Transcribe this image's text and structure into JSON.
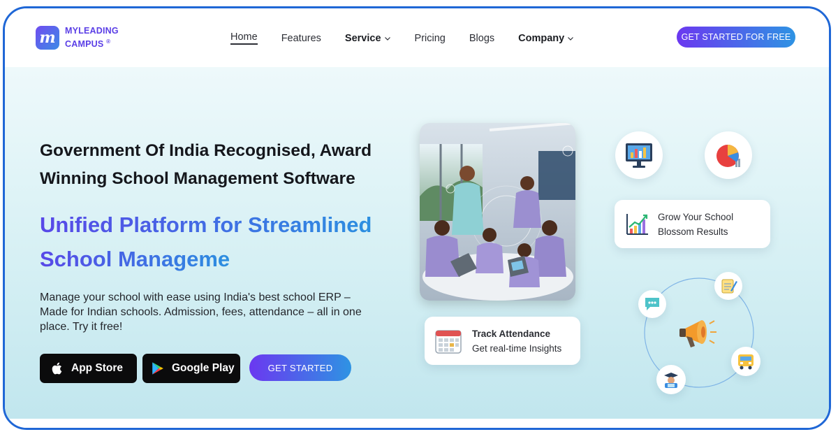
{
  "brand": {
    "logo_letter": "m",
    "line1": "MYLEADING",
    "line2": "CAMPUS",
    "registered": "®",
    "color": "#5a3ee6"
  },
  "nav": {
    "items": [
      {
        "label": "Home",
        "active": true
      },
      {
        "label": "Features"
      },
      {
        "label": "Service",
        "dropdown": true
      },
      {
        "label": "Pricing"
      },
      {
        "label": "Blogs"
      },
      {
        "label": "Company",
        "dropdown": true
      }
    ],
    "cta": "GET STARTED FOR FREE"
  },
  "hero": {
    "title_line1": "Government Of India Recognised, Award",
    "title_line2": "Winning School Management Software",
    "subtitle_line1": "Unified Platform for Streamlined",
    "subtitle_line2": "School Manageme",
    "description_line1": "Manage your school with ease using India's best school ERP –",
    "description_line2": "Made for Indian schools. Admission, fees, attendance – all in one",
    "description_line3": "place. Try it free!",
    "app_store": "App Store",
    "google_play": "Google Play",
    "cta": "GET STARTED"
  },
  "cards": {
    "attendance_title": "Track Attendance",
    "attendance_sub": "Get real-time Insights",
    "grow_title": "Grow Your School",
    "grow_sub": "Blossom Results"
  },
  "icons": {
    "monitor": "monitor-chart-icon",
    "pie": "pie-chart-icon",
    "growth": "growth-chart-icon",
    "calendar": "calendar-icon",
    "megaphone": "megaphone-icon",
    "chat": "chat-bubble-icon",
    "notepad": "notepad-icon",
    "bus": "school-bus-icon",
    "graduate": "graduate-icon"
  },
  "colors": {
    "accent_purple": "#6b38f0",
    "accent_blue": "#2e93e3",
    "frame_border": "#1f67d6"
  }
}
